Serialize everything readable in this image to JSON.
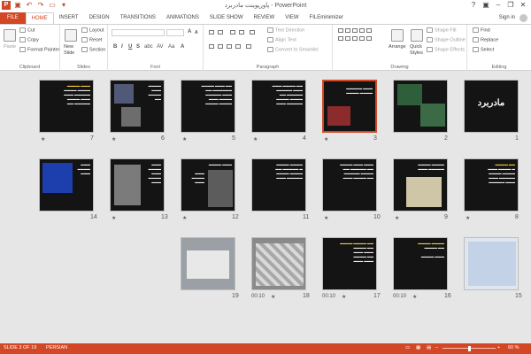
{
  "window": {
    "title": "پاورپوینت مادربرد - PowerPoint",
    "sign_in": "Sign in"
  },
  "tabs": [
    "FILE",
    "HOME",
    "INSERT",
    "DESIGN",
    "TRANSITIONS",
    "ANIMATIONS",
    "SLIDE SHOW",
    "REVIEW",
    "VIEW",
    "FILEminimizer"
  ],
  "ribbon": {
    "clipboard": {
      "name": "Clipboard",
      "paste": "Paste",
      "cut": "Cut",
      "copy": "Copy",
      "format_painter": "Format Painter"
    },
    "slides": {
      "name": "Slides",
      "new_slide": "New",
      "new_slide2": "Slide",
      "layout": "Layout",
      "reset": "Reset",
      "section": "Section"
    },
    "font": {
      "name": "Font"
    },
    "paragraph": {
      "name": "Paragraph",
      "text_direction": "Text Direction",
      "align_text": "Align Text",
      "convert_smartart": "Convert to SmartArt"
    },
    "drawing": {
      "name": "Drawing",
      "arrange": "Arrange",
      "quick_styles": "Quick",
      "quick_styles2": "Styles",
      "shape_fill": "Shape Fill",
      "shape_outline": "Shape Outline",
      "shape_effects": "Shape Effects"
    },
    "editing": {
      "name": "Editing",
      "find": "Find",
      "replace": "Replace",
      "select": "Select"
    }
  },
  "slides": [
    {
      "n": "1",
      "title": "مادربرد",
      "star": "",
      "timer": ""
    },
    {
      "n": "2",
      "star": "",
      "timer": ""
    },
    {
      "n": "3",
      "star": "★",
      "timer": "",
      "selected": true
    },
    {
      "n": "4",
      "star": "★",
      "timer": ""
    },
    {
      "n": "5",
      "star": "★",
      "timer": ""
    },
    {
      "n": "6",
      "star": "★",
      "timer": ""
    },
    {
      "n": "7",
      "star": "★",
      "timer": ""
    },
    {
      "n": "8",
      "star": "★",
      "timer": ""
    },
    {
      "n": "9",
      "star": "★",
      "timer": ""
    },
    {
      "n": "10",
      "star": "★",
      "timer": ""
    },
    {
      "n": "11",
      "star": "",
      "timer": ""
    },
    {
      "n": "12",
      "star": "★",
      "timer": ""
    },
    {
      "n": "13",
      "star": "★",
      "timer": ""
    },
    {
      "n": "14",
      "star": "",
      "timer": ""
    },
    {
      "n": "15",
      "star": "",
      "timer": ""
    },
    {
      "n": "16",
      "star": "★",
      "timer": "00:10"
    },
    {
      "n": "17",
      "star": "★",
      "timer": "00:10"
    },
    {
      "n": "18",
      "star": "★",
      "timer": "00:10"
    },
    {
      "n": "19",
      "star": "",
      "timer": ""
    }
  ],
  "status": {
    "slide": "SLIDE 3 OF 19",
    "lang": "PERSIAN",
    "zoom": "60 %",
    "zoom_level": 0.6
  },
  "colors": {
    "accent": "#d24726",
    "highlight": "#ffd43b"
  }
}
